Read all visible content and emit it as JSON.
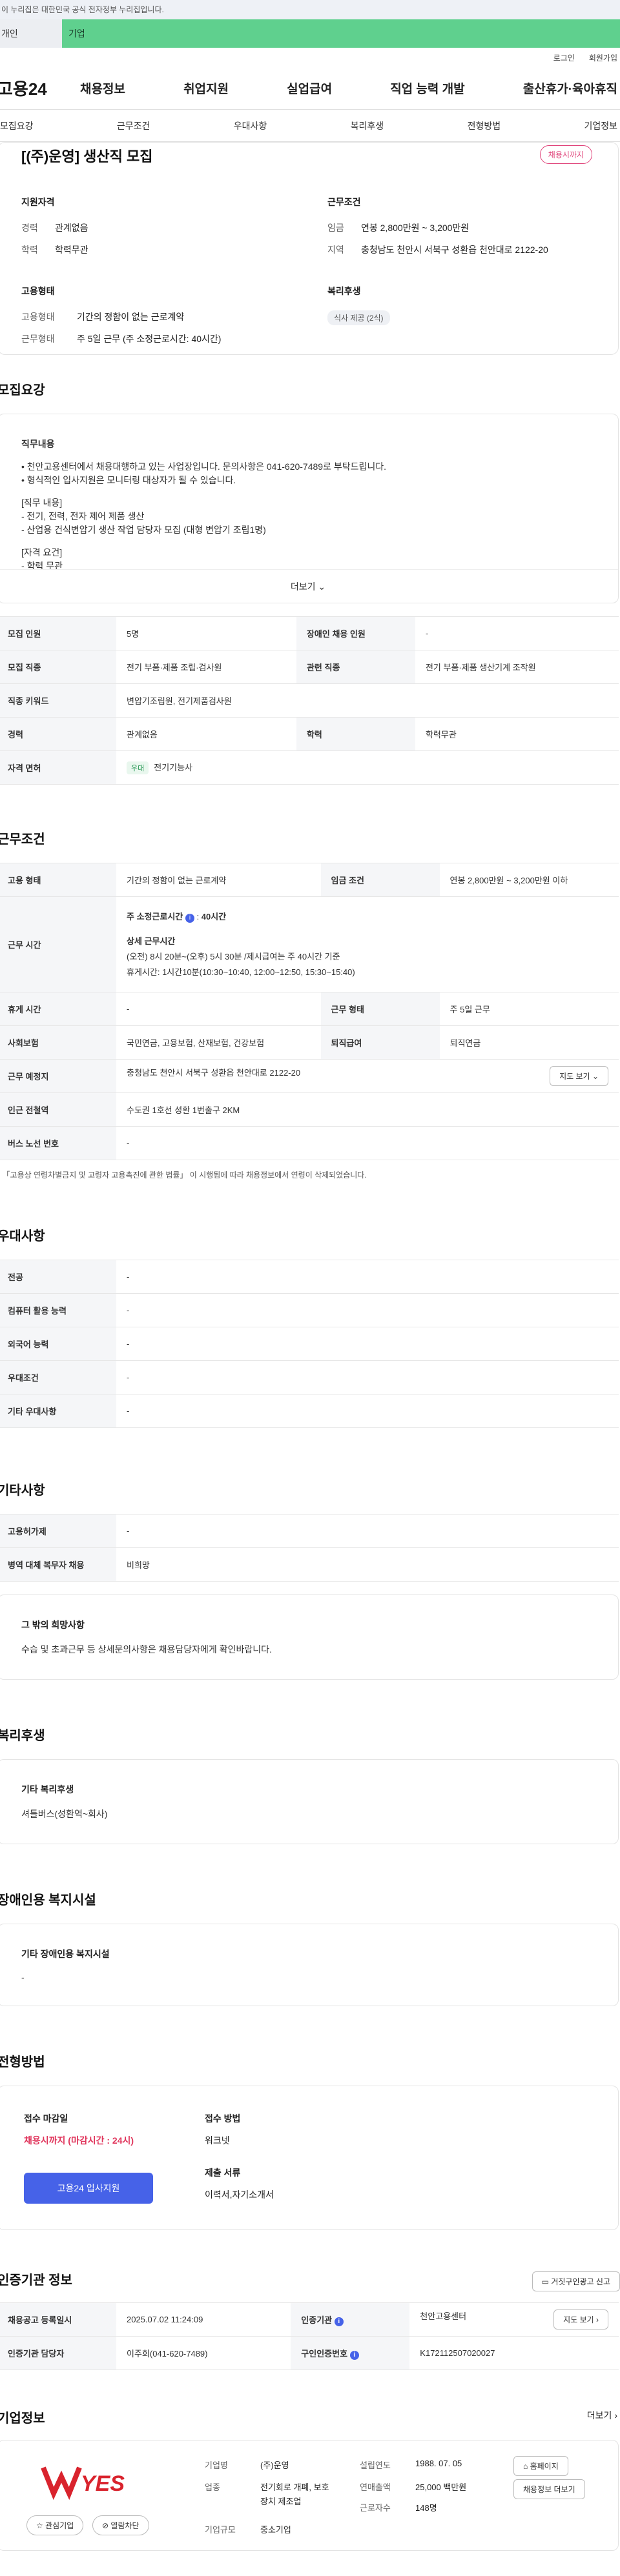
{
  "gov_banner": "이 누리집은 대한민국 공식 전자정부 누리집입니다.",
  "top_tabs": {
    "personal": "개인",
    "corporate": "기업"
  },
  "util": {
    "login": "로그인",
    "join": "회원가입"
  },
  "logo": "고용24",
  "gnb": [
    "채용정보",
    "취업지원",
    "실업급여",
    "직업 능력 개발",
    "출산휴가·육아휴직"
  ],
  "subnav": [
    "모집요강",
    "근무조건",
    "우대사항",
    "복리후생",
    "전형방법",
    "기업정보"
  ],
  "summary": {
    "title": "[(주)운영] 생산직 모집",
    "badge": "채용시까지",
    "qual_title": "지원자격",
    "qual": [
      {
        "k": "경력",
        "v": "관계없음"
      },
      {
        "k": "학력",
        "v": "학력무관"
      }
    ],
    "work_title": "근무조건",
    "work": [
      {
        "k": "임금",
        "v": "연봉 2,800만원 ~ 3,200만원"
      },
      {
        "k": "지역",
        "v": "충청남도 천안시 서북구 성환읍 천안대로 2122-20"
      }
    ],
    "emp_title": "고용형태",
    "emp": [
      {
        "k": "고용형태",
        "v": "기간의 정함이 없는 근로계약"
      },
      {
        "k": "근무형태",
        "v": "주 5일 근무 (주 소정근로시간: 40시간)"
      }
    ],
    "welfare_title": "복리후생",
    "welfare_chip": "식사 제공 (2식)"
  },
  "recruit": {
    "title": "모집요강",
    "desc_lines": [
      "직무내용",
      "",
      "• 천안고용센터에서 채용대행하고 있는 사업장입니다. 문의사항은 041-620-7489로 부탁드립니다.",
      "• 형식적인 입사지원은 모니터링 대상자가 될 수 있습니다.",
      "",
      "[직무 내용]",
      " - 전기, 전력, 전자 제어 제품 생산",
      " - 산업용 건식변압기 생산 작업 담당자 모집 (대형 변압기 조립1명)",
      "",
      "[자격 요건]",
      " - 학력 무관"
    ],
    "more": "더보기",
    "rows": [
      [
        {
          "k": "모집 인원",
          "v": "5명"
        },
        {
          "k": "장애인 채용 인원",
          "v": "-"
        }
      ],
      [
        {
          "k": "모집 직종",
          "v": "전기 부품·제품 조립·검사원"
        },
        {
          "k": "관련 직종",
          "v": "전기 부품·제품 생산기계 조작원"
        }
      ],
      [
        {
          "k": "직종 키워드",
          "v": "변압기조립원, 전기제품검사원"
        }
      ],
      [
        {
          "k": "경력",
          "v": "관계없음"
        },
        {
          "k": "학력",
          "v": "학력무관"
        }
      ],
      [
        {
          "k": "자격 면허",
          "v": "전기기능사",
          "badge": "우대"
        }
      ]
    ]
  },
  "conditions": {
    "title": "근무조건",
    "emp_type": {
      "k": "고용 형태",
      "v": "기간의 정함이 없는 근로계약"
    },
    "wage": {
      "k": "임금 조건",
      "v": "연봉 2,800만원 ~ 3,200만원 이하"
    },
    "hours": {
      "k": "근무 시간",
      "line1": "주 소정근로시간",
      "line1b": "40시간",
      "line2": "상세 근무시간",
      "line3": "(오전) 8시 20분~(오후) 5시 30분 /제시급여는 주 40시간 기준",
      "line4": "휴게시간: 1시간10분(10:30~10:40, 12:00~12:50, 15:30~15:40)"
    },
    "rest": {
      "k": "휴게 시간",
      "v": "-"
    },
    "work_form": {
      "k": "근무 형태",
      "v": "주 5일 근무"
    },
    "insurance": {
      "k": "사회보험",
      "v": "국민연금, 고용보험, 산재보험, 건강보험"
    },
    "retire": {
      "k": "퇴직급여",
      "v": "퇴직연금"
    },
    "location": {
      "k": "근무 예정지",
      "v": "충청남도 천안시 서북구 성환읍 천안대로 2122-20",
      "btn": "지도 보기"
    },
    "station": {
      "k": "인근 전철역",
      "v": "수도권 1호선 성환 1번출구 2KM"
    },
    "bus": {
      "k": "버스 노선 번호",
      "v": "-"
    },
    "note": "• 「고용상 연령차별금지 및 고령자 고용촉진에 관한 법률」 이 시행됨에 따라 채용정보에서 연령이 삭제되었습니다."
  },
  "preference": {
    "title": "우대사항",
    "rows": [
      {
        "k": "전공",
        "v": "-"
      },
      {
        "k": "컴퓨터 활용 능력",
        "v": "-"
      },
      {
        "k": "외국어 능력",
        "v": "-"
      },
      {
        "k": "우대조건",
        "v": "-"
      },
      {
        "k": "기타 우대사항",
        "v": "-"
      }
    ]
  },
  "etc": {
    "title": "기타사항",
    "rows": [
      {
        "k": "고용허가제",
        "v": "-"
      },
      {
        "k": "병역 대체 복무자 채용",
        "v": "비희망"
      }
    ],
    "card_h": "그 밖의 희망사항",
    "card_b": "수습 및 초과근무 등 상세문의사항은 채용담당자에게 확인바랍니다."
  },
  "welfare": {
    "title": "복리후생",
    "h": "기타 복리후생",
    "b": "셔틀버스(성환역~회사)"
  },
  "disabled": {
    "title": "장애인용 복지시설",
    "h": "기타 장애인용 복지시설",
    "b": "-"
  },
  "process": {
    "title": "전형방법",
    "deadline_h": "접수 마감일",
    "deadline_v": "채용시까지 (마감시간 : 24시)",
    "apply_btn": "고용24 입사지원",
    "method_h": "접수 방법",
    "method_v": "워크넷",
    "docs_h": "제출 서류",
    "docs_v": "이력서,자기소개서"
  },
  "cert": {
    "title": "인증기관 정보",
    "report_btn": "거짓구인광고 신고",
    "rows": [
      [
        {
          "k": "채용공고 등록일시",
          "v": "2025.07.02 11:24:09"
        },
        {
          "k": "인증기관",
          "v": "천안고용센터",
          "btn": "지도 보기"
        }
      ],
      [
        {
          "k": "인증기관 담당자",
          "v": "이주희(041-620-7489)"
        },
        {
          "k": "구인인증번호",
          "v": "K172112507020027"
        }
      ]
    ]
  },
  "company": {
    "title": "기업정보",
    "more": "더보기",
    "logo_text": "WYES",
    "fav_btn": "관심기업",
    "block_btn": "열람차단",
    "name_k": "기업명",
    "name_v": "(주)운영",
    "biz_k": "업종",
    "biz_v": "전기회로 개폐, 보호장치 제조업",
    "size_k": "기업규모",
    "size_v": "중소기업",
    "found_k": "설립연도",
    "found_v": "1988. 07. 05",
    "sales_k": "연매출액",
    "sales_v": "25,000 백만원",
    "emp_k": "근로자수",
    "emp_v": "148명",
    "homepage_btn": "홈페이지",
    "jobs_btn": "채용정보 더보기"
  },
  "colors": {
    "accent": "#4662e8",
    "badge": "#e0457b",
    "green_tab": "#5fd08e"
  }
}
